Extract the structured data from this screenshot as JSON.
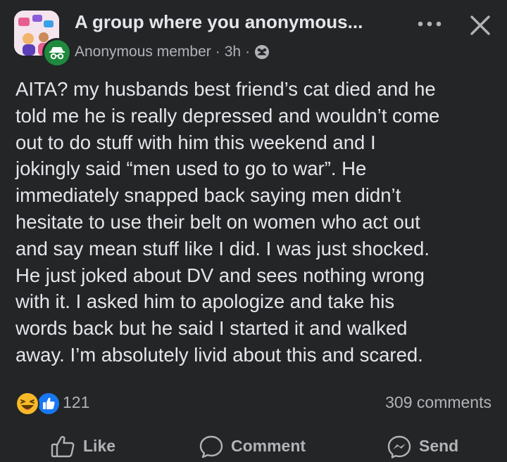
{
  "header": {
    "group_name": "A group where you anonymous...",
    "author": "Anonymous member",
    "separator": "·",
    "time": "3h",
    "privacy_icon": "group-audience-icon",
    "more_icon": "more-options-icon",
    "close_icon": "close-icon"
  },
  "post": {
    "lines": [
      "AITA? my husbands best friend’s cat died and he",
      "told me he is really depressed and wouldn’t come",
      "out to do stuff with him this weekend and I",
      "jokingly said “men used to go to war”. He",
      "immediately snapped back saying men didn’t",
      "hesitate to use their belt on women who act out",
      "and say mean stuff like I did. I was just shocked.",
      "He just joked about DV and sees nothing wrong",
      "with it. I asked him to apologize and take his",
      "words back but he said I started it and walked",
      "away. I’m absolutely livid about this and scared."
    ]
  },
  "stats": {
    "reactions": [
      "haha",
      "like"
    ],
    "reaction_count": "121",
    "comment_count": "309 comments"
  },
  "actions": {
    "like": "Like",
    "comment": "Comment",
    "send": "Send"
  },
  "colors": {
    "background": "#242526",
    "text_primary": "#e4e6eb",
    "text_secondary": "#b0b3b8",
    "like_blue": "#1877f2",
    "haha_yellow": "#f7b928"
  }
}
